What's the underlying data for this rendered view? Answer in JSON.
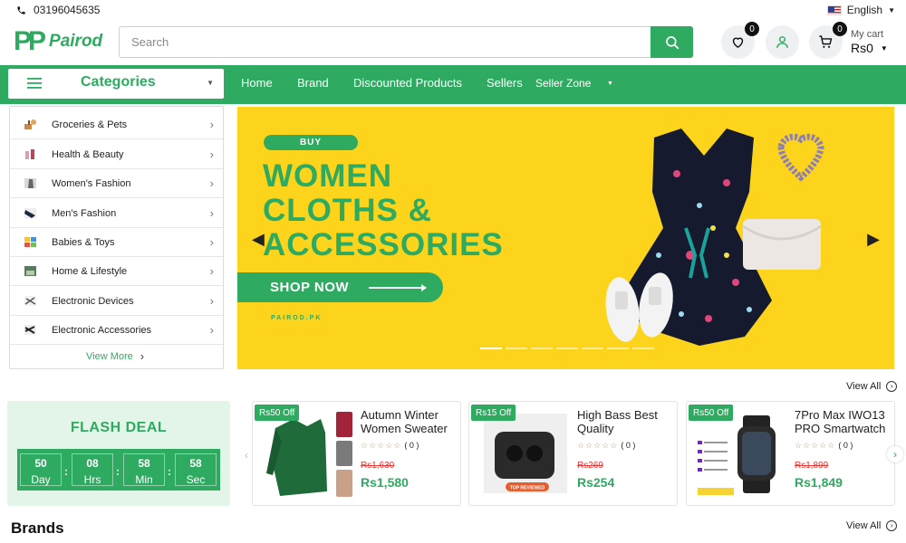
{
  "topbar": {
    "phone": "03196045635",
    "language": "English"
  },
  "header": {
    "logo_text": "Pairod",
    "logo_mark": "PP",
    "search_placeholder": "Search",
    "wishlist_count": "0",
    "cart_count": "0",
    "cart_label": "My cart",
    "cart_amount": "Rs0"
  },
  "nav": {
    "categories_label": "Categories",
    "items": [
      "Home",
      "Brand",
      "Discounted Products",
      "Sellers",
      "Seller Zone"
    ]
  },
  "sidebar": {
    "items": [
      {
        "label": "Groceries & Pets"
      },
      {
        "label": "Health & Beauty"
      },
      {
        "label": "Women's Fashion"
      },
      {
        "label": "Men's Fashion"
      },
      {
        "label": "Babies & Toys"
      },
      {
        "label": "Home & Lifestyle"
      },
      {
        "label": "Electronic Devices"
      },
      {
        "label": "Electronic Accessories"
      }
    ],
    "view_more": "View More"
  },
  "banner": {
    "buy": "BUY",
    "line1": "WOMEN",
    "line2": "CLOTHS &",
    "line3": "ACCESSORIES",
    "cta": "SHOP NOW",
    "site": "PAIROD.PK",
    "slide_count": 7,
    "active_slide": 1
  },
  "flash_deal": {
    "title": "FLASH DEAL",
    "timer": [
      {
        "value": "50",
        "unit": "Day"
      },
      {
        "value": "08",
        "unit": "Hrs"
      },
      {
        "value": "58",
        "unit": "Min"
      },
      {
        "value": "58",
        "unit": "Sec"
      }
    ]
  },
  "products": {
    "view_all": "View All",
    "items": [
      {
        "badge": "Rs50 Off",
        "name": "Autumn Winter Women Sweater",
        "stars": "☆☆☆☆☆",
        "reviews": "( 0 )",
        "old_price": "Rs1,630",
        "price": "Rs1,580"
      },
      {
        "badge": "Rs15 Off",
        "name": "High Bass Best Quality",
        "stars": "☆☆☆☆☆",
        "reviews": "( 0 )",
        "old_price": "Rs269",
        "price": "Rs254"
      },
      {
        "badge": "Rs50 Off",
        "name": "7Pro Max IWO13 PRO Smartwatch",
        "stars": "☆☆☆☆☆",
        "reviews": "( 0 )",
        "old_price": "Rs1,899",
        "price": "Rs1,849"
      }
    ]
  },
  "brands": {
    "title": "Brands",
    "view_all": "View All"
  },
  "colors": {
    "brand_green": "#2eab60",
    "banner_yellow": "#fcd41b",
    "flash_bg": "#e3f5e8",
    "sale_red": "#e53935"
  }
}
